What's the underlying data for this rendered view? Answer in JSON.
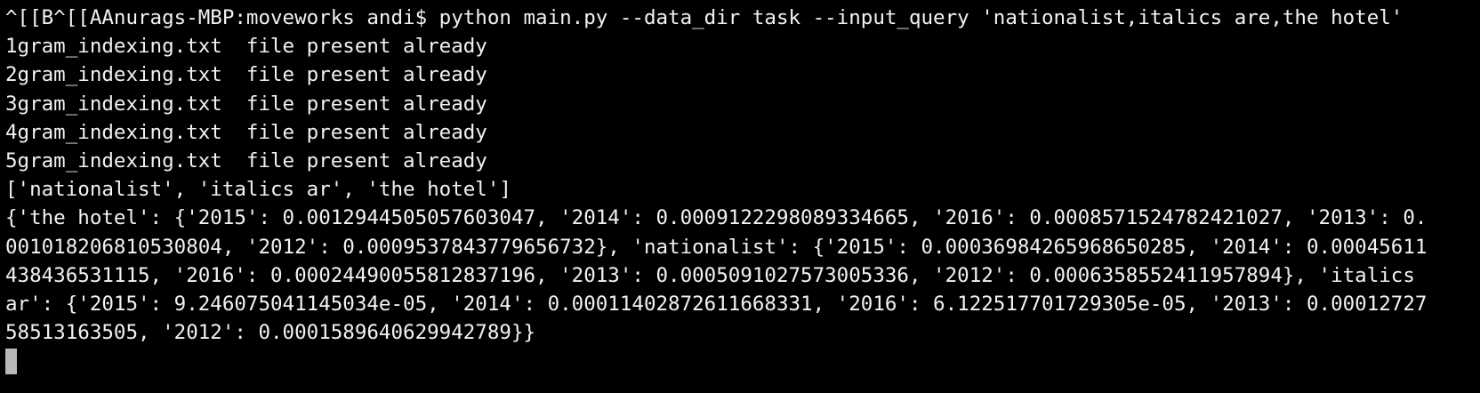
{
  "terminal": {
    "lines": [
      "^[[B^[[AAnurags-MBP:moveworks andi$ python main.py --data_dir task --input_query 'nationalist,italics are,the hotel'",
      "1gram_indexing.txt  file present already",
      "2gram_indexing.txt  file present already",
      "3gram_indexing.txt  file present already",
      "4gram_indexing.txt  file present already",
      "5gram_indexing.txt  file present already",
      "['nationalist', 'italics ar', 'the hotel']",
      "{'the hotel': {'2015': 0.0012944505057603047, '2014': 0.0009122298089334665, '2016': 0.0008571524782421027, '2013': 0.",
      "001018206810530804, '2012': 0.0009537843779656732}, 'nationalist': {'2015': 0.00036984265968650285, '2014': 0.00045611",
      "438436531115, '2016': 0.0002449005581283719​6, '2013': 0.0005091027573005336, '2012': 0.0006358552411957894}, 'italics",
      "ar': {'2015': 9.246075041145034e-05, '2014': 0.00011402872611668331, '2016': 6.122517701729305e-05, '2013': 0.00012727",
      "58513163505, '2012': 0.00015896406299427​89}}"
    ],
    "colors": {
      "background": "#000000",
      "foreground": "#f2f2f2",
      "cursor": "#b8b8b8"
    }
  }
}
